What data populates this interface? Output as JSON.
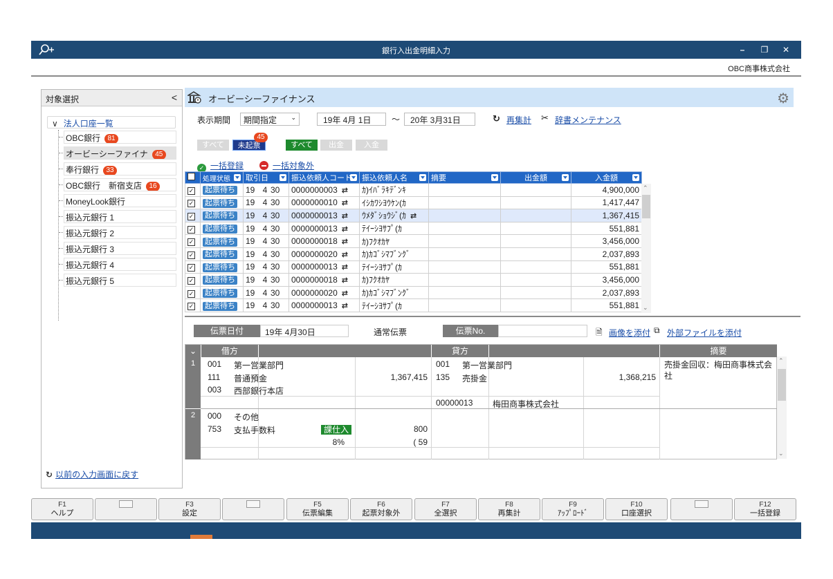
{
  "window": {
    "title": "銀行入出金明細入力",
    "company": "OBC商事株式会社",
    "min": "–",
    "restore": "❐",
    "close": "✕"
  },
  "left": {
    "header": "対象選択",
    "collapse": "<",
    "root": "法人口座一覧",
    "items": [
      {
        "label": "OBC銀行",
        "badge": "81"
      },
      {
        "label": "オービーシーファイナ",
        "badge": "45"
      },
      {
        "label": "奉行銀行",
        "badge": "33"
      },
      {
        "label": "OBC銀行　新宿支店",
        "badge": "16"
      },
      {
        "label": "MoneyLook銀行",
        "badge": ""
      },
      {
        "label": "振込元銀行 1",
        "badge": ""
      },
      {
        "label": "振込元銀行 2",
        "badge": ""
      },
      {
        "label": "振込元銀行 3",
        "badge": ""
      },
      {
        "label": "振込元銀行 4",
        "badge": ""
      },
      {
        "label": "振込元銀行 5",
        "badge": ""
      }
    ],
    "back": "以前の入力画面に戻す"
  },
  "main": {
    "bank_name": "オービーシーファイナンス",
    "period_label": "表示期間",
    "period_select": "期間指定",
    "date_from": "19年  4月  1日",
    "date_sep": "～",
    "date_to": "20年  3月31日",
    "recalc": "再集計",
    "dict": "辞書メンテナンス",
    "filter1": {
      "all": "すべて",
      "unissued": "未起票",
      "badge": "45"
    },
    "filter2": {
      "all": "すべて",
      "out": "出金",
      "in": "入金"
    },
    "bulk_register": "一括登録",
    "bulk_exclude": "一括対象外"
  },
  "grid": {
    "headers": [
      "処理状態",
      "取引日",
      "振込依頼人コード",
      "振込依頼人名",
      "摘要",
      "出金額",
      "入金額"
    ],
    "rows": [
      {
        "status": "起票待ち",
        "y": "19",
        "m": "4",
        "d": "30",
        "code": "0000000003",
        "name": "ｶ)ｲﾊﾞﾗｷﾃﾞﾝｷ",
        "out": "",
        "in": "4,900,000"
      },
      {
        "status": "起票待ち",
        "y": "19",
        "m": "4",
        "d": "30",
        "code": "0000000010",
        "name": "ｲｼｶﾜｼﾖｳｹﾝ(ｶ",
        "out": "",
        "in": "1,417,447"
      },
      {
        "status": "起票待ち",
        "y": "19",
        "m": "4",
        "d": "30",
        "code": "0000000013",
        "name": "ｳﾒﾀﾞｼｮｳｼﾞ(ｶ",
        "out": "",
        "in": "1,367,415"
      },
      {
        "status": "起票待ち",
        "y": "19",
        "m": "4",
        "d": "30",
        "code": "0000000013",
        "name": "ﾃｲｰｼﾖｻﾌﾟ(ｶ",
        "out": "",
        "in": "551,881"
      },
      {
        "status": "起票待ち",
        "y": "19",
        "m": "4",
        "d": "30",
        "code": "0000000018",
        "name": "ｶ)ﾌｸｵｶﾔ",
        "out": "",
        "in": "3,456,000"
      },
      {
        "status": "起票待ち",
        "y": "19",
        "m": "4",
        "d": "30",
        "code": "0000000020",
        "name": "ｶ)ｶｺﾞｼﾏﾌﾞﾝｸﾞ",
        "out": "",
        "in": "2,037,893"
      },
      {
        "status": "起票待ち",
        "y": "19",
        "m": "4",
        "d": "30",
        "code": "0000000013",
        "name": "ﾃｲｰｼﾖｻﾌﾟ(ｶ",
        "out": "",
        "in": "551,881"
      },
      {
        "status": "起票待ち",
        "y": "19",
        "m": "4",
        "d": "30",
        "code": "0000000018",
        "name": "ｶ)ﾌｸｵｶﾔ",
        "out": "",
        "in": "3,456,000"
      },
      {
        "status": "起票待ち",
        "y": "19",
        "m": "4",
        "d": "30",
        "code": "0000000020",
        "name": "ｶ)ｶｺﾞｼﾏﾌﾞﾝｸﾞ",
        "out": "",
        "in": "2,037,893"
      },
      {
        "status": "起票待ち",
        "y": "19",
        "m": "4",
        "d": "30",
        "code": "0000000013",
        "name": "ﾃｲｰｼﾖｻﾌﾟ(ｶ",
        "out": "",
        "in": "551,881"
      }
    ],
    "highlight_row": 2
  },
  "voucher": {
    "date_label": "伝票日付",
    "date": "19年  4月30日",
    "type": "通常伝票",
    "no_label": "伝票No.",
    "no": "",
    "attach_image": "画像を添付",
    "attach_file": "外部ファイルを添付"
  },
  "journal": {
    "head_debit": "借方",
    "head_credit": "貸方",
    "head_memo": "摘要",
    "row1": {
      "num": "1",
      "d_dept_code": "001",
      "d_dept": "第一営業部門",
      "d_acct_code": "111",
      "d_acct": "普通預金",
      "d_amount": "1,367,415",
      "d_sub_code": "003",
      "d_sub": "西部銀行本店",
      "c_dept_code": "001",
      "c_dept": "第一営業部門",
      "c_acct_code": "135",
      "c_acct": "売掛金",
      "c_amount": "1,368,215",
      "c_partner_code": "00000013",
      "c_partner": "梅田商事株式会社",
      "memo": "売掛金回収：梅田商事株式会社"
    },
    "row2": {
      "num": "2",
      "d_dept_code": "000",
      "d_dept": "その他",
      "d_acct_code": "753",
      "d_acct": "支払手数料",
      "tax": "課仕入",
      "d_amount": "800",
      "rate": "8%",
      "tax_amount": "(    59"
    }
  },
  "fkeys": [
    {
      "key": "F1",
      "label": "ヘルプ"
    },
    {
      "key": "",
      "label": ""
    },
    {
      "key": "F3",
      "label": "設定"
    },
    {
      "key": "",
      "label": ""
    },
    {
      "key": "F5",
      "label": "伝票編集"
    },
    {
      "key": "F6",
      "label": "起票対象外"
    },
    {
      "key": "F7",
      "label": "全選択"
    },
    {
      "key": "F8",
      "label": "再集計"
    },
    {
      "key": "F9",
      "label": "ｱｯﾌﾟﾛｰﾄﾞ"
    },
    {
      "key": "F10",
      "label": "口座選択"
    },
    {
      "key": "",
      "label": ""
    },
    {
      "key": "F12",
      "label": "一括登録"
    }
  ],
  "colors": {
    "titlebar": "#1e4a75",
    "grid_header": "#2167c6",
    "badge": "#e8481f",
    "link": "#1b4ea8"
  }
}
